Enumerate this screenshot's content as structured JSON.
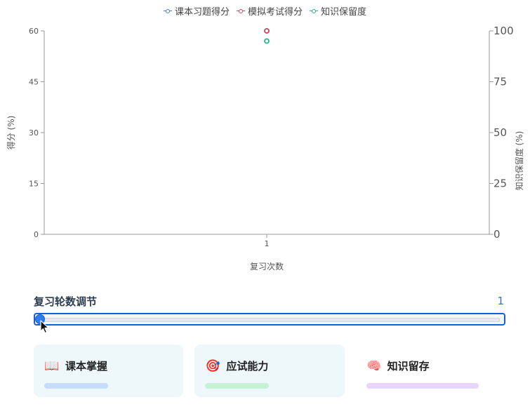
{
  "chart_data": {
    "type": "scatter",
    "x": [
      1
    ],
    "series": [
      {
        "name": "课本习题得分",
        "values": [
          60
        ],
        "axis": "left",
        "color": "#4a7fd6"
      },
      {
        "name": "模拟考试得分",
        "values": [
          60
        ],
        "axis": "left",
        "color": "#d64a5a"
      },
      {
        "name": "知识保留度",
        "values": [
          95
        ],
        "axis": "right",
        "color": "#2bb38a"
      }
    ],
    "xlabel": "复习次数",
    "ylabel": "得分 (%)",
    "y2label": "知识保留度 (%)",
    "ylim": [
      0,
      60
    ],
    "yticks": [
      0,
      15,
      30,
      45,
      60
    ],
    "y2lim": [
      0,
      100
    ],
    "y2ticks": [
      0,
      25,
      50,
      75,
      100
    ],
    "xticks": [
      1
    ],
    "legend_position": "top-center",
    "grid": false
  },
  "slider": {
    "title": "复习轮数调节",
    "value": "1"
  },
  "cards": [
    {
      "icon": "📖",
      "title": "课本掌握",
      "bar_color": "#c6dcfb",
      "bar_fill": 0.5
    },
    {
      "icon": "🎯",
      "title": "应试能力",
      "bar_color": "#c5f1d4",
      "bar_fill": 0.5
    },
    {
      "icon": "🧠",
      "title": "知识留存",
      "bar_color": "#e8d6fa",
      "bar_fill": 0.88
    }
  ]
}
